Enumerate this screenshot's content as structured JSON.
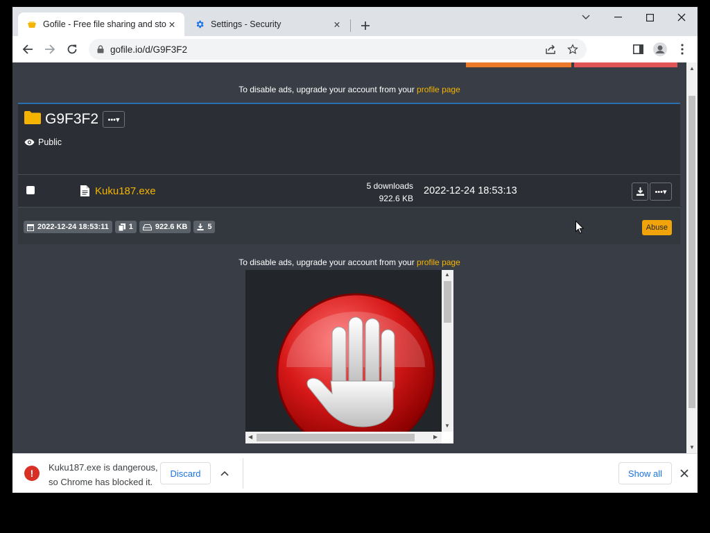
{
  "tabs": [
    {
      "title": "Gofile - Free file sharing and stor",
      "active": true,
      "icon": "gofile-favicon"
    },
    {
      "title": "Settings - Security",
      "active": false,
      "icon": "gear-icon"
    }
  ],
  "toolbar": {
    "url": "gofile.io/d/G9F3F2"
  },
  "page": {
    "ad_note_prefix": "To disable ads, upgrade your account from your",
    "ad_note_link": "profile page",
    "folder": {
      "name": "G9F3F2",
      "visibility": "Public"
    },
    "file": {
      "name": "Kuku187.exe",
      "downloads": "5 downloads",
      "size": "922.6 KB",
      "date": "2022-12-24 18:53:13"
    },
    "footer": {
      "created": "2022-12-24 18:53:11",
      "file_count": "1",
      "total_size": "922.6 KB",
      "total_downloads": "5",
      "abuse_label": "Abuse"
    }
  },
  "download_bar": {
    "message_line1": "Kuku187.exe is dangerous,",
    "message_line2": "so Chrome has blocked it.",
    "discard_label": "Discard",
    "show_all_label": "Show all"
  },
  "colors": {
    "accent": "#f5b400",
    "page_bg": "#393e46",
    "card_bg": "#2b2f35",
    "danger": "#d93025",
    "link_blue": "#1a73e8"
  }
}
